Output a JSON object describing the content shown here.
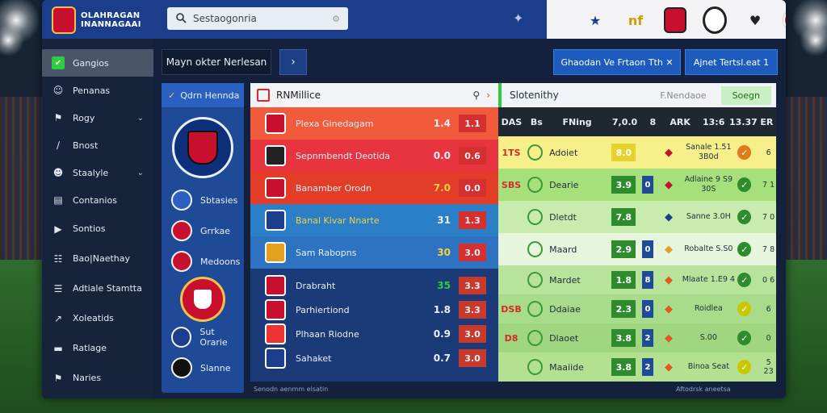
{
  "app": {
    "logo_line1": "OLAHRAGAN",
    "logo_line2": "INANNAGAAI"
  },
  "search": {
    "placeholder": "Sestaogonria"
  },
  "sidebar": {
    "items": [
      {
        "label": "Gangios",
        "icon": "check-icon",
        "active": true
      },
      {
        "label": "Penanas",
        "icon": "people-icon"
      },
      {
        "label": "Rogy",
        "icon": "trophy-icon",
        "chevron": true
      },
      {
        "label": "Bnost",
        "icon": "chart-icon"
      },
      {
        "label": "Staalyle",
        "icon": "user-icon",
        "chevron": true
      },
      {
        "label": "Contanios",
        "icon": "folder-icon"
      },
      {
        "label": "Sontios",
        "icon": "play-icon"
      },
      {
        "label": "Bao|Naethay",
        "icon": "grid-icon"
      },
      {
        "label": "Adtiale Stamtta",
        "icon": "board-icon"
      },
      {
        "label": "Xoleatids",
        "icon": "person-run-icon"
      },
      {
        "label": "Ratlage",
        "icon": "ticket-icon"
      },
      {
        "label": "Naries",
        "icon": "flag-icon"
      }
    ]
  },
  "subheader": {
    "title": "Mayn okter Nerlesan",
    "btn1": "Ghaodan Ve Frtaon Tth ✕",
    "btn2": "Ajnet Tertsl.eat 1"
  },
  "leagues": {
    "title": "Qdrn Hennda",
    "rows": [
      {
        "label": "Sbtasies"
      },
      {
        "label": "Grrkae"
      },
      {
        "label": "Medoons"
      },
      {
        "label": "Sut Orarie"
      },
      {
        "label": "Slanne"
      }
    ]
  },
  "matches": {
    "title": "RNMillice",
    "rows": [
      {
        "name": "Plexa Ginedagam",
        "s1": "1.4",
        "s2": "1.1",
        "bg": "#f15a3a",
        "crest": "#c8102e"
      },
      {
        "name": "Sepnmbendt Deotida",
        "s1": "0.0",
        "s2": "0.6",
        "bg": "#e8343f",
        "crest": "#222"
      },
      {
        "name": "Banamber Orodn",
        "s1": "7.0",
        "s2": "0.0",
        "bg": "#e33d28",
        "crest": "#c8102e",
        "s1c": "#f4d03f"
      },
      {
        "name": "Banal Kivar Nnarte",
        "s1": "31",
        "s2": "1.3",
        "bg": "#2a7fc7",
        "crest": "#1a3e8c",
        "name_c": "#f4d03f"
      },
      {
        "name": "Sam Rabopns",
        "s1": "30",
        "s2": "3.0",
        "bg": "#2d73c1",
        "crest": "#e0a020",
        "s1c": "#f4d03f"
      },
      {
        "name": "Drabraht",
        "s1": "35",
        "s2": "3.3",
        "bg": "#1b3a78",
        "crest": "#c8102e",
        "s1c": "#2ecc40",
        "dark": true
      },
      {
        "name": "Parhiertiond",
        "s1": "1.8",
        "s2": "3.3",
        "bg": "#1b3a78",
        "crest": "#c8102e",
        "dark": true
      },
      {
        "name": "Plhaan Riodne",
        "s1": "0.9",
        "s2": "3.0",
        "bg": "#1b3a78",
        "crest": "#e33",
        "dark": true
      },
      {
        "name": "Sahaket",
        "s1": "0.7",
        "s2": "3.0",
        "bg": "#1b3a78",
        "crest": "#1a3e8c",
        "dark": true
      }
    ]
  },
  "stats": {
    "title": "Slotenithy",
    "link": "F.Nendaoe",
    "button": "Soegn",
    "cols": [
      "DAS",
      "Bs",
      "FNing",
      "7,0.0",
      "8",
      "ARK",
      "13:6",
      "13.37",
      "ER"
    ],
    "rows": [
      {
        "c0": "1TS",
        "name": "Adoiet",
        "val": "8.0",
        "v2": "",
        "team": "Sanale 1.51 3B0d",
        "tr": "6",
        "bg": "#f7f08a",
        "vbg": "#e4d42a",
        "ic_c": "#c8102e",
        "tc": "#e07a1a"
      },
      {
        "c0": "SBS",
        "name": "Dearie",
        "val": "3.9",
        "v2": "0",
        "team": "Adlaine 9 S9 30S",
        "tr": "7 1",
        "bg": "#a6e07a",
        "vbg": "#2e8b2e",
        "ic_c": "#c8102e",
        "tc": "#2e8b2e"
      },
      {
        "c0": "",
        "name": "Dletdt",
        "val": "7.8",
        "v2": "",
        "team": "Sanne 3.0H",
        "tr": "7 0",
        "bg": "#c8ecae",
        "vbg": "#2e8b2e",
        "ic_c": "#1a3e8c",
        "tc": "#2e8b2e"
      },
      {
        "c0": "",
        "name": "Maard",
        "val": "2.9",
        "v2": "0",
        "team": "Robalte S.S0",
        "tr": "7 8",
        "bg": "#e6f5dc",
        "vbg": "#2e8b2e",
        "ic_c": "#e0a020",
        "tc": "#2e8b2e"
      },
      {
        "c0": "",
        "name": "Mardet",
        "val": "1.8",
        "v2": "8",
        "team": "Mlaate 1.E9 4",
        "tr": "0 6",
        "bg": "#b7e39a",
        "vbg": "#2e8b2e",
        "ic_c": "#e05a1a",
        "tc": "#2e8b2e"
      },
      {
        "c0": "DSB",
        "name": "Ddaiae",
        "val": "2.3",
        "v2": "0",
        "team": "Roidlea",
        "tr": "6",
        "bg": "#a9dc8a",
        "vbg": "#2e8b2e",
        "ic_c": "#e05a1a",
        "tc": "#c8c800"
      },
      {
        "c0": "D8",
        "name": "Dlaoet",
        "val": "3.8",
        "v2": "2",
        "team": "S.00",
        "tr": "0",
        "bg": "#a0d67f",
        "vbg": "#2e8b2e",
        "ic_c": "#e05a1a",
        "tc": "#2e8b2e"
      },
      {
        "c0": "",
        "name": "Maaiide",
        "val": "3.8",
        "v2": "2",
        "team": "Binoa Seat",
        "tr": "5 23",
        "bg": "#b4e091",
        "vbg": "#2e8b2e",
        "ic_c": "#e05a1a",
        "tc": "#c8c800"
      }
    ]
  },
  "footer": {
    "left": "Senodn aenmm elsatin",
    "right": "Aftodrsk aneetsa"
  }
}
